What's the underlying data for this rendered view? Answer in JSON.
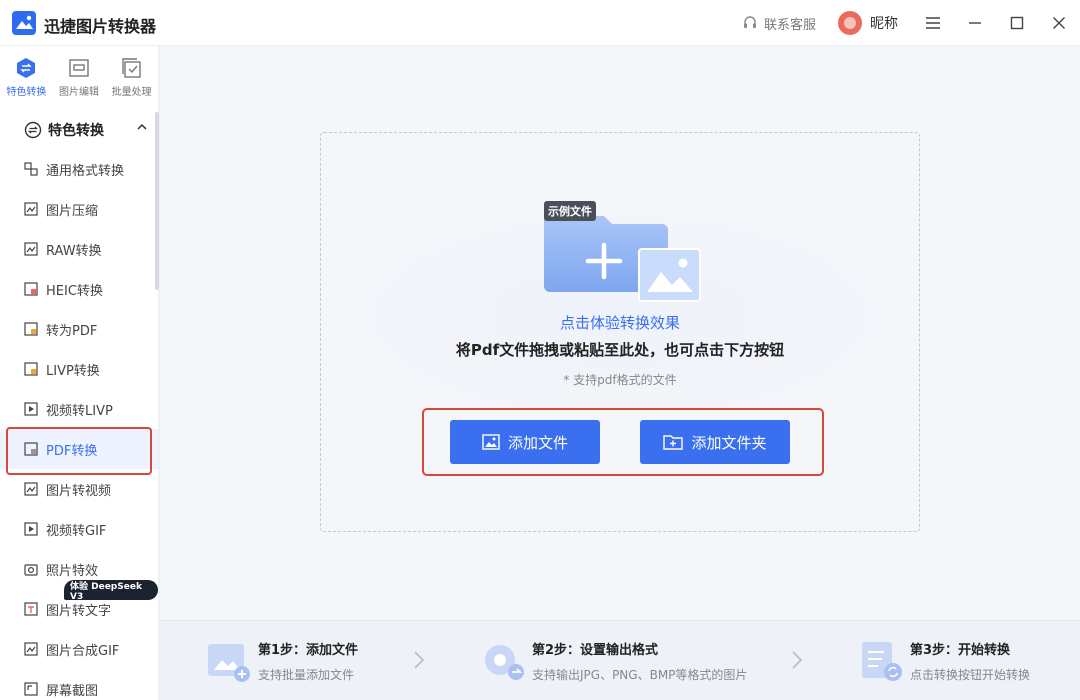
{
  "app": {
    "title": "迅捷图片转换器"
  },
  "titlebar": {
    "support": "联系客服",
    "nickname": "昵称"
  },
  "rail": [
    {
      "label": "特色转换",
      "icon": "convert-icon",
      "active": true
    },
    {
      "label": "图片编辑",
      "icon": "image-edit-icon",
      "active": false
    },
    {
      "label": "批量处理",
      "icon": "batch-icon",
      "active": false
    }
  ],
  "sidebar": {
    "group": "特色转换",
    "items": [
      {
        "label": "通用格式转换"
      },
      {
        "label": "图片压缩"
      },
      {
        "label": "RAW转换"
      },
      {
        "label": "HEIC转换"
      },
      {
        "label": "转为PDF"
      },
      {
        "label": "LIVP转换"
      },
      {
        "label": "视频转LIVP"
      },
      {
        "label": "PDF转换",
        "active": true
      },
      {
        "label": "图片转视频"
      },
      {
        "label": "视频转GIF"
      },
      {
        "label": "照片特效"
      },
      {
        "label": "图片转文字"
      },
      {
        "label": "图片合成GIF"
      },
      {
        "label": "屏幕截图"
      }
    ],
    "badge": "体验 DeepSeek V3"
  },
  "dropzone": {
    "sample_tag": "示例文件",
    "try_link": "点击体验转换效果",
    "instruction": "将Pdf文件拖拽或粘贴至此处，也可点击下方按钮",
    "support_note": "* 支持pdf格式的文件",
    "add_file": "添加文件",
    "add_folder": "添加文件夹"
  },
  "steps": [
    {
      "title": "第1步：添加文件",
      "desc": "支持批量添加文件"
    },
    {
      "title": "第2步：设置输出格式",
      "desc": "支持输出JPG、PNG、BMP等格式的图片"
    },
    {
      "title": "第3步：开始转换",
      "desc": "点击转换按钮开始转换"
    }
  ],
  "colors": {
    "accent": "#3a6ff0",
    "highlight": "#d8473b"
  }
}
